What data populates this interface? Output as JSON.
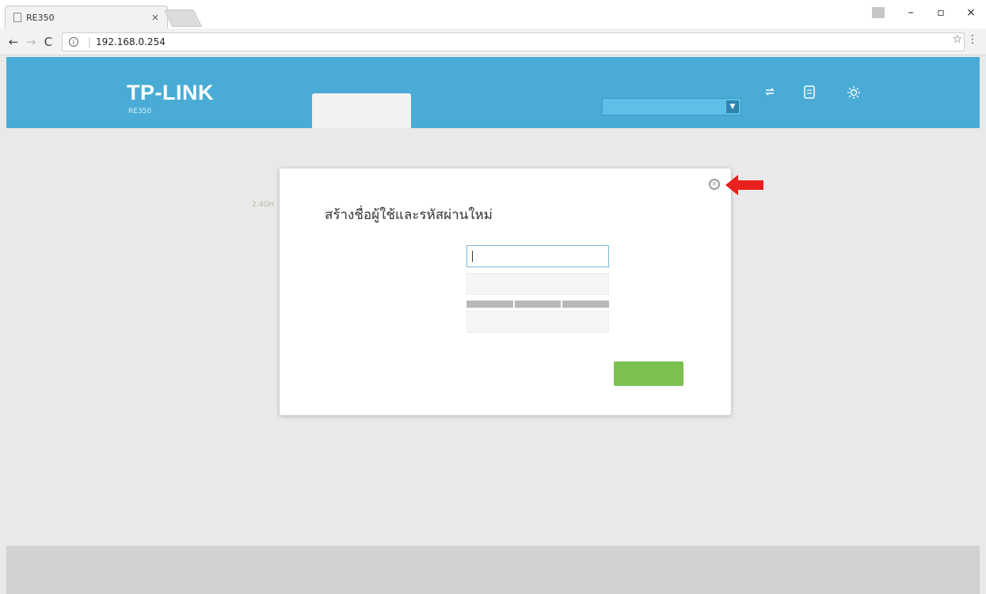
{
  "browser": {
    "tab_title": "RE350",
    "tab_close": "×",
    "security_label": "",
    "url": "192.168.0.254",
    "window_controls": {
      "minimize": "–",
      "maximize": "▫",
      "close": "×"
    },
    "nav": {
      "back": "←",
      "forward": "→",
      "reload": "C"
    },
    "star": "☆",
    "menu": "⋮"
  },
  "header": {
    "logo": "TP-LINK",
    "model": "RE350",
    "tabs": [
      {
        "label_line1": "",
        "label_line2": ""
      },
      {
        "label": ""
      }
    ],
    "language_select": "",
    "icons": [
      {
        "name": "reboot-icon",
        "label": ""
      },
      {
        "name": "guide-icon",
        "label": ""
      },
      {
        "name": "sun-icon",
        "label": ""
      }
    ]
  },
  "background": {
    "network_label": "",
    "status_label": "",
    "band_label": "2.4GH"
  },
  "modal": {
    "title": "สร้างชื่อผู้ใช้และรหัสผ่านใหม่",
    "username_label": "",
    "password_label": "",
    "confirm_label": "",
    "strength_segments": [
      "",
      "",
      ""
    ],
    "save_label": ""
  },
  "footer": {
    "firmware": "",
    "hardware": "",
    "support": ""
  },
  "colors": {
    "header_blue": "#4aacd6",
    "save_green": "#7cc14f",
    "annotation_red": "#e8211c"
  }
}
